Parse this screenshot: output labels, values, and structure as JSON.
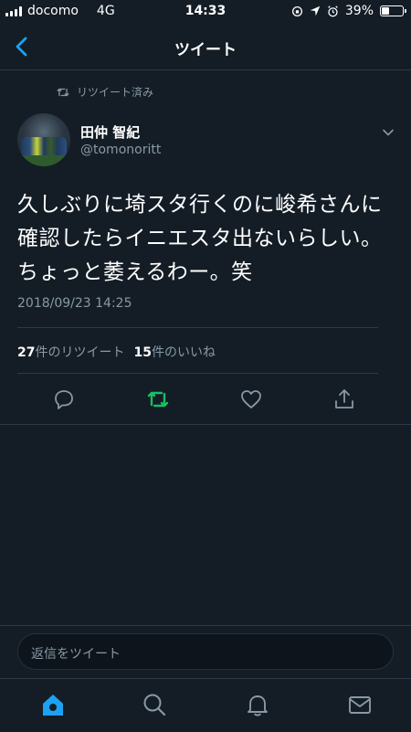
{
  "status_bar": {
    "carrier": "docomo",
    "network": "4G",
    "time": "14:33",
    "battery": "39%",
    "battery_level": 0.39
  },
  "nav": {
    "title": "ツイート"
  },
  "tweet": {
    "retweet_label": "リツイート済み",
    "display_name": "田仲 智紀",
    "handle": "@tomonoritt",
    "text": "久しぶりに埼スタ行くのに峻希さんに確認したらイニエスタ出ないらしい。ちょっと萎えるわー。笑",
    "timestamp": "2018/09/23 14:25",
    "retweet_count": "27",
    "retweet_suffix": "件のリツイート",
    "like_count": "15",
    "like_suffix": "件のいいね"
  },
  "reply": {
    "placeholder": "返信をツイート"
  },
  "colors": {
    "background": "#141d26",
    "accent": "#1da1f2",
    "retweet_green": "#17bf63",
    "muted": "#8899a6"
  },
  "icons": {
    "back": "chevron-left-icon",
    "retweet": "retweet-icon",
    "caret": "chevron-down-icon",
    "reply": "reply-icon",
    "like": "heart-icon",
    "share": "share-icon",
    "home": "home-icon",
    "search": "search-icon",
    "notifications": "bell-icon",
    "messages": "mail-icon"
  }
}
